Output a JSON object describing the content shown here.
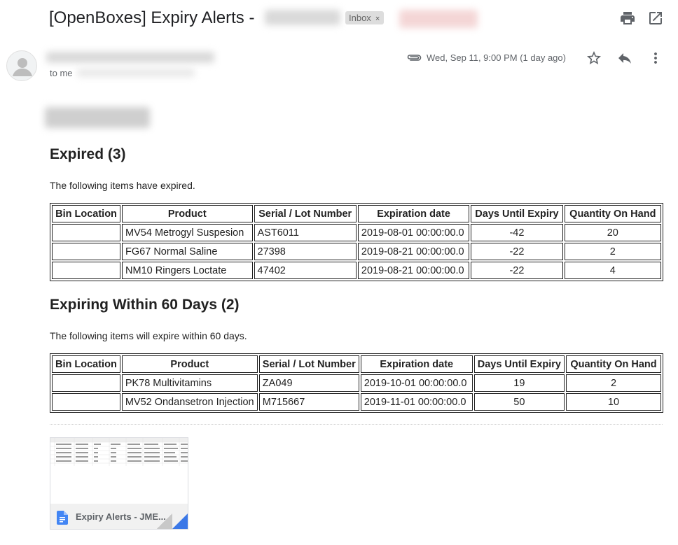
{
  "header": {
    "subject": "[OpenBoxes] Expiry Alerts -",
    "inbox_label": "Inbox",
    "inbox_close": "×"
  },
  "sender": {
    "to_label": "to me",
    "date": "Wed, Sep 11, 9:00 PM (1 day ago)"
  },
  "icons": {
    "print": "print-icon",
    "open_new": "open-in-new-window-icon",
    "attachment": "paperclip-icon",
    "star": "star-icon",
    "reply": "reply-icon",
    "more": "more-vert-icon",
    "avatar": "person-avatar-icon",
    "doc": "google-sheets-doc-icon"
  },
  "expired": {
    "title": "Expired (3)",
    "description": "The following items have expired.",
    "headers": [
      "Bin Location",
      "Product",
      "Serial / Lot Number",
      "Expiration date",
      "Days Until Expiry",
      "Quantity On Hand"
    ],
    "rows": [
      [
        "",
        "MV54 Metrogyl Suspesion",
        "AST6011",
        "2019-08-01 00:00:00.0",
        "-42",
        "20"
      ],
      [
        "",
        "FG67 Normal Saline",
        "27398",
        "2019-08-21 00:00:00.0",
        "-22",
        "2"
      ],
      [
        "",
        "NM10 Ringers Loctate",
        "47402",
        "2019-08-21 00:00:00.0",
        "-22",
        "4"
      ]
    ]
  },
  "expiring": {
    "title": "Expiring Within 60 Days (2)",
    "description": "The following items will expire within 60 days.",
    "headers": [
      "Bin Location",
      "Product",
      "Serial / Lot Number",
      "Expiration date",
      "Days Until Expiry",
      "Quantity On Hand"
    ],
    "rows": [
      [
        "",
        "PK78 Multivitamins",
        "ZA049",
        "2019-10-01 00:00:00.0",
        "19",
        "2"
      ],
      [
        "",
        "MV52 Ondansetron Injection",
        "M715667",
        "2019-11-01 00:00:00.0",
        "50",
        "10"
      ]
    ]
  },
  "attachment": {
    "name": "Expiry Alerts - JME..."
  },
  "colors": {
    "accent_blue": "#4285f4",
    "corner_blue": "#3b78e7",
    "chip_bg": "#dddddd",
    "icon_gray": "#5f6368"
  }
}
